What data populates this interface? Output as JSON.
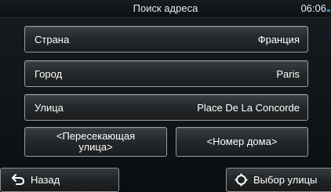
{
  "header": {
    "title": "Поиск адреса",
    "time": "06:06"
  },
  "fields": [
    {
      "label": "Страна",
      "value": "Франция"
    },
    {
      "label": "Город",
      "value": "Paris"
    },
    {
      "label": "Улица",
      "value": "Place De La Concorde"
    }
  ],
  "options": {
    "cross_street_line1": "<Пересекающая",
    "cross_street_line2": "улица>",
    "house_number": "<Номер дома>"
  },
  "footer": {
    "back_label": "Назад",
    "select_label": "Выбор улицы"
  }
}
